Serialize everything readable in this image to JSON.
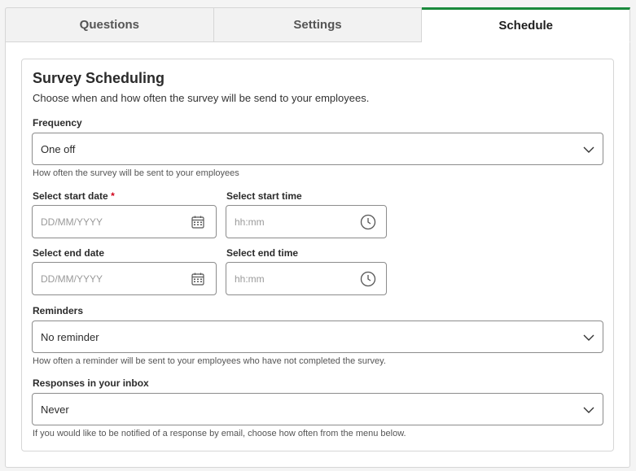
{
  "tabs": [
    {
      "label": "Questions"
    },
    {
      "label": "Settings"
    },
    {
      "label": "Schedule"
    }
  ],
  "active_tab": "Schedule",
  "accent_color": "#1a8a3c",
  "section": {
    "title": "Survey Scheduling",
    "subtitle": "Choose when and how often the survey will be send to your employees."
  },
  "frequency": {
    "label": "Frequency",
    "value": "One off",
    "help": "How often the survey will be sent to your employees"
  },
  "start_date": {
    "label": "Select start date",
    "required_mark": "*",
    "placeholder": "DD/MM/YYYY"
  },
  "start_time": {
    "label": "Select start time",
    "placeholder": "hh:mm"
  },
  "end_date": {
    "label": "Select end date",
    "placeholder": "DD/MM/YYYY"
  },
  "end_time": {
    "label": "Select end time",
    "placeholder": "hh:mm"
  },
  "reminders": {
    "label": "Reminders",
    "value": "No reminder",
    "help": "How often a reminder will be sent to your employees who have not completed the survey."
  },
  "inbox": {
    "label": "Responses in your inbox",
    "value": "Never",
    "help": "If you would like to be notified of a response by email, choose how often from the menu below."
  },
  "icons": {
    "date": "calendar-icon",
    "time": "clock-icon",
    "dropdown": "chevron-down-icon"
  }
}
